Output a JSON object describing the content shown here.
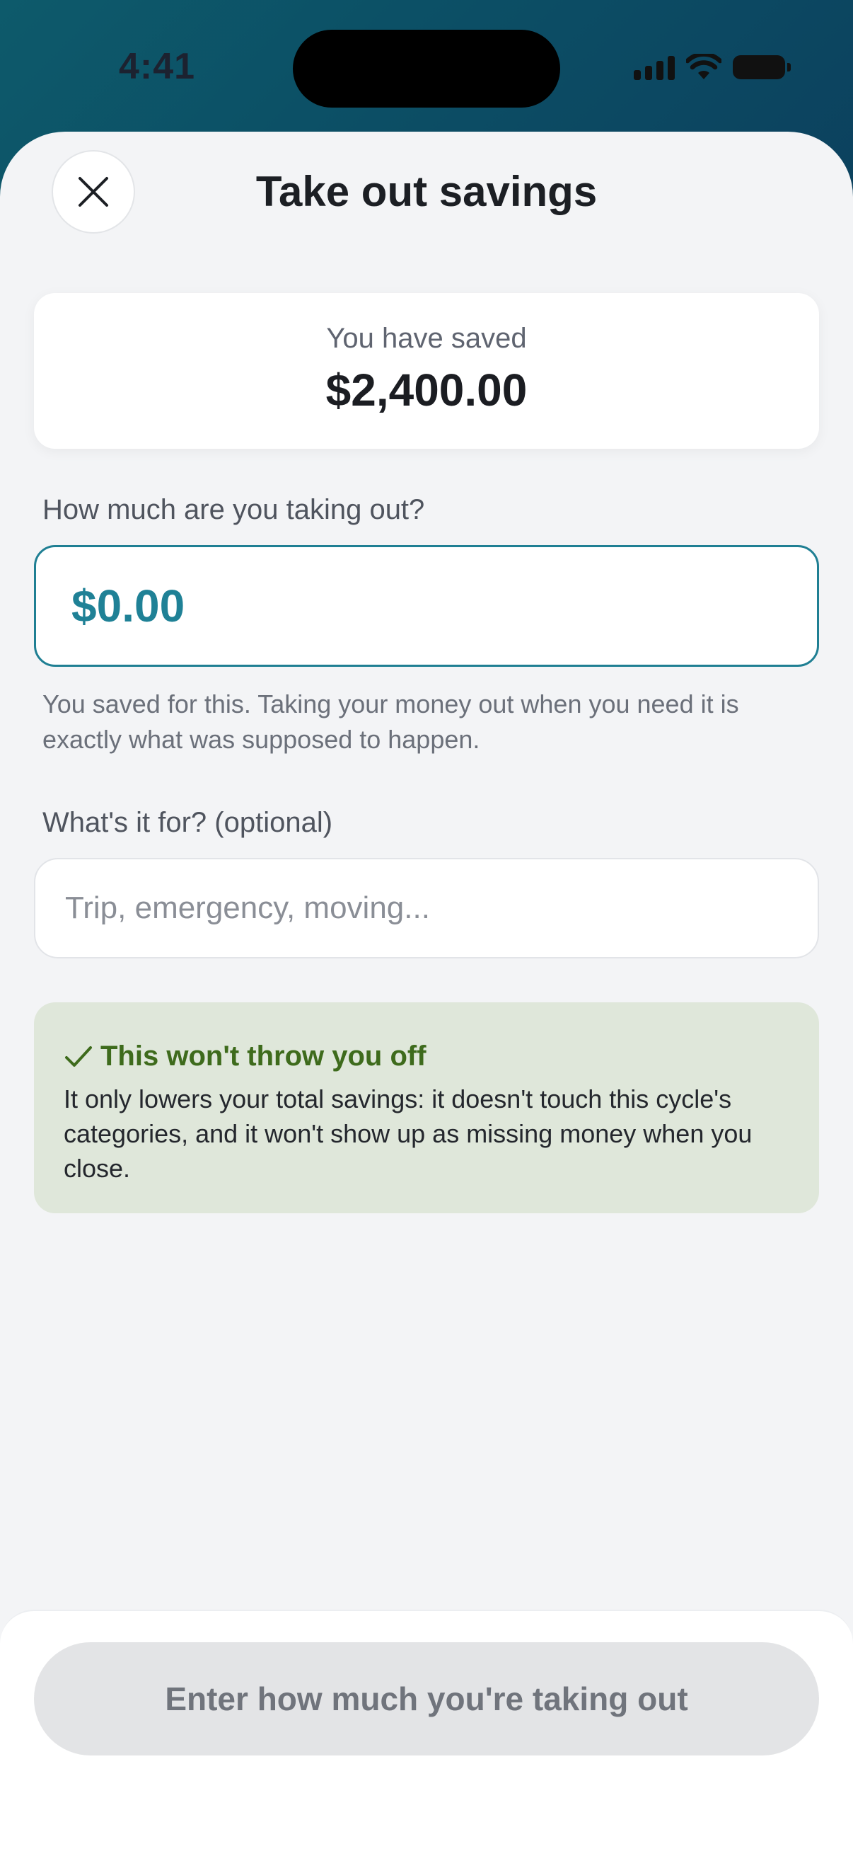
{
  "status_bar": {
    "time": "4:41",
    "signal_icon": "cellular-signal-icon",
    "wifi_icon": "wifi-icon",
    "battery_icon": "battery-icon"
  },
  "header": {
    "close_icon": "close-icon",
    "title": "Take out savings"
  },
  "saved_card": {
    "label": "You have saved",
    "amount": "$2,400.00"
  },
  "amount_field": {
    "label": "How much are you taking out?",
    "value": "$0.00",
    "helper": "You saved for this. Taking your money out when you need it is exactly what was supposed to happen."
  },
  "purpose_field": {
    "label": "What's it for? (optional)",
    "placeholder": "Trip, emergency, moving..."
  },
  "info_card": {
    "icon": "checkmark-icon",
    "title": "This won't throw you off",
    "body": "It only lowers your total savings: it doesn't touch this cycle's categories, and it won't show up as missing money when you close."
  },
  "footer": {
    "cta_label": "Enter how much you're taking out"
  },
  "colors": {
    "accent": "#1f8196",
    "success_bg": "#dfe7da",
    "success_text": "#3e6b1c",
    "disabled_button": "#e3e4e6"
  }
}
